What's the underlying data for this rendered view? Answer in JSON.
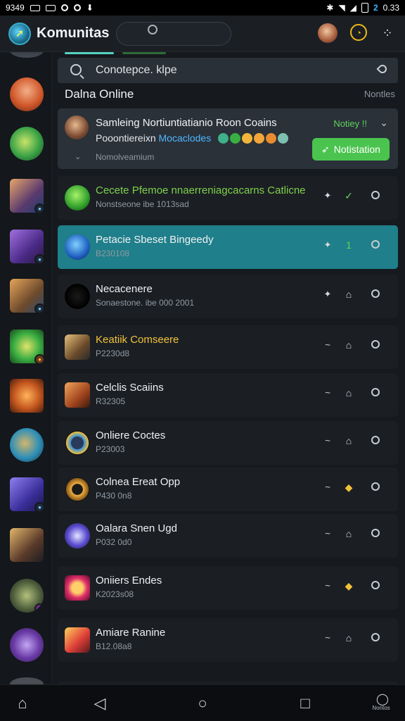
{
  "status_bar": {
    "time_left": "9349",
    "time_right": "0.33",
    "battery": "2"
  },
  "header": {
    "title": "Komunitas",
    "search_placeholder": ""
  },
  "search": {
    "text": "Conotepce. klpe"
  },
  "section": {
    "title": "Dalna Online",
    "note": "Nontles"
  },
  "notice": {
    "line1": "Samleing Nortiuntiatianio Roon Coains",
    "line2_prefix": "Pooontiereixn",
    "line2_highlight": "Mocaclodes",
    "line3": "Nomolveamium",
    "label": "Notiey !!",
    "button": "Notistation"
  },
  "rows": [
    {
      "name": "Cecete Pfemoe nnaerreniagcacarns Catlicne",
      "sub": "Nonstseone ibe 1013sad",
      "a1": "✦",
      "a2": "✓",
      "highlight_name": true
    },
    {
      "name": "Petacie Sbeset Bingeedy",
      "sub": "B230108",
      "a1": "✦",
      "a2": "1",
      "active": true
    },
    {
      "name": "Necacenere",
      "sub": "Sonaestone. ibe 000 2001",
      "a1": "✦",
      "a2": "⌂"
    },
    {
      "name": "Keatiik Comseere",
      "sub": "P2230d8",
      "a1": "~",
      "a2": "⌂",
      "gold": true
    },
    {
      "name": "Celclis Scaiins",
      "sub": "R32305",
      "a1": "~",
      "a2": "⌂"
    },
    {
      "name": "Onliere Coctes",
      "sub": "P23003",
      "a1": "~",
      "a2": "⌂"
    },
    {
      "name": "Colnea Ereat Opp",
      "sub": "P430 0n8",
      "a1": "~",
      "a2": "◆"
    },
    {
      "name": "Oalara Snen Ugd",
      "sub": "P032 0d0",
      "a1": "~",
      "a2": "⌂"
    },
    {
      "name": "Oniiers Endes",
      "sub": "K2023s08",
      "a1": "~",
      "a2": "◆"
    },
    {
      "name": "Amiare Ranine",
      "sub": "B12.08a8",
      "a1": "~",
      "a2": "⌂"
    }
  ],
  "nav": {
    "label": "Nontos"
  },
  "colors": {
    "accent": "#4bc44f",
    "active_row": "#1f7f8a",
    "highlight": "#7fd04a"
  }
}
